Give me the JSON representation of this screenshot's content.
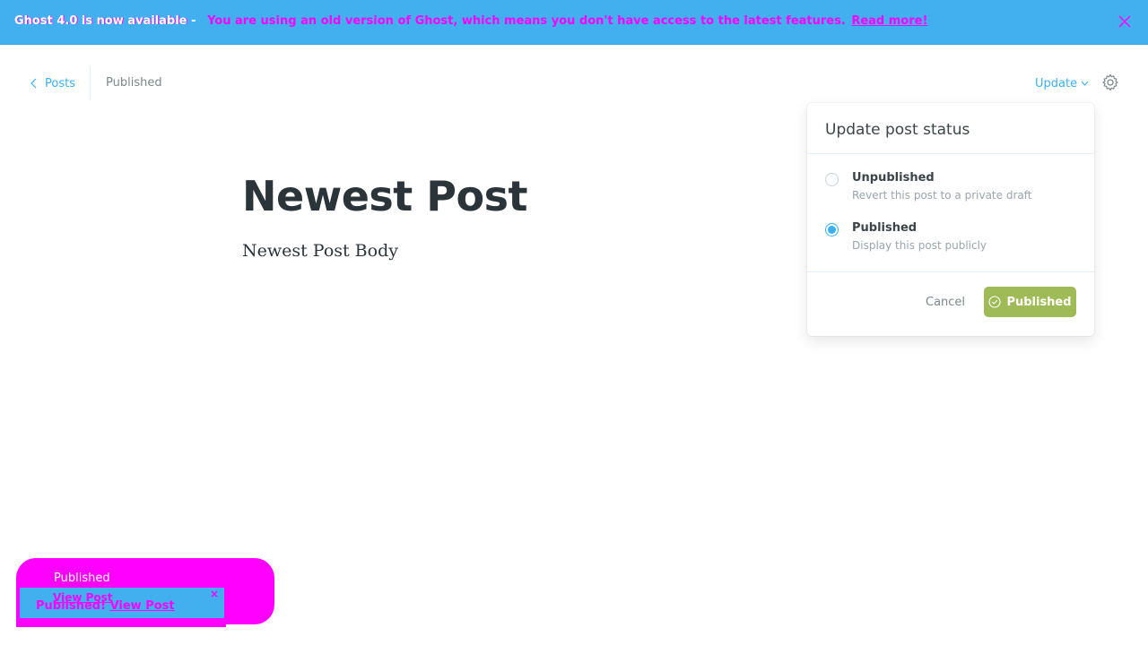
{
  "banner": {
    "title": "Ghost 4.0 is now available",
    "separator": " - ",
    "message": "You are using an old version of Ghost, which means you don't have access to the latest features.",
    "link": "Read more!"
  },
  "header": {
    "back_label": "Posts",
    "status": "Published",
    "update_label": "Update"
  },
  "post": {
    "title": "Newest Post",
    "body": "Newest Post Body"
  },
  "publish_menu": {
    "title": "Update post status",
    "options": [
      {
        "label": "Unpublished",
        "description": "Revert this post to a private draft",
        "selected": false
      },
      {
        "label": "Published",
        "description": "Display this post publicly",
        "selected": true
      }
    ],
    "cancel_label": "Cancel",
    "confirm_label": "Published"
  },
  "notification": {
    "title": "Published",
    "ghost_link": "View Post",
    "message_prefix": "Published!",
    "link": "View Post",
    "close": "×"
  },
  "colors": {
    "accent": "#3eb0ef",
    "banner": "#42b0ee",
    "success": "#9fbb58",
    "glitch": "#ff00ff"
  },
  "icons": [
    "close-icon",
    "chevron-left-icon",
    "chevron-down-icon",
    "gear-icon",
    "check-circle-icon"
  ]
}
